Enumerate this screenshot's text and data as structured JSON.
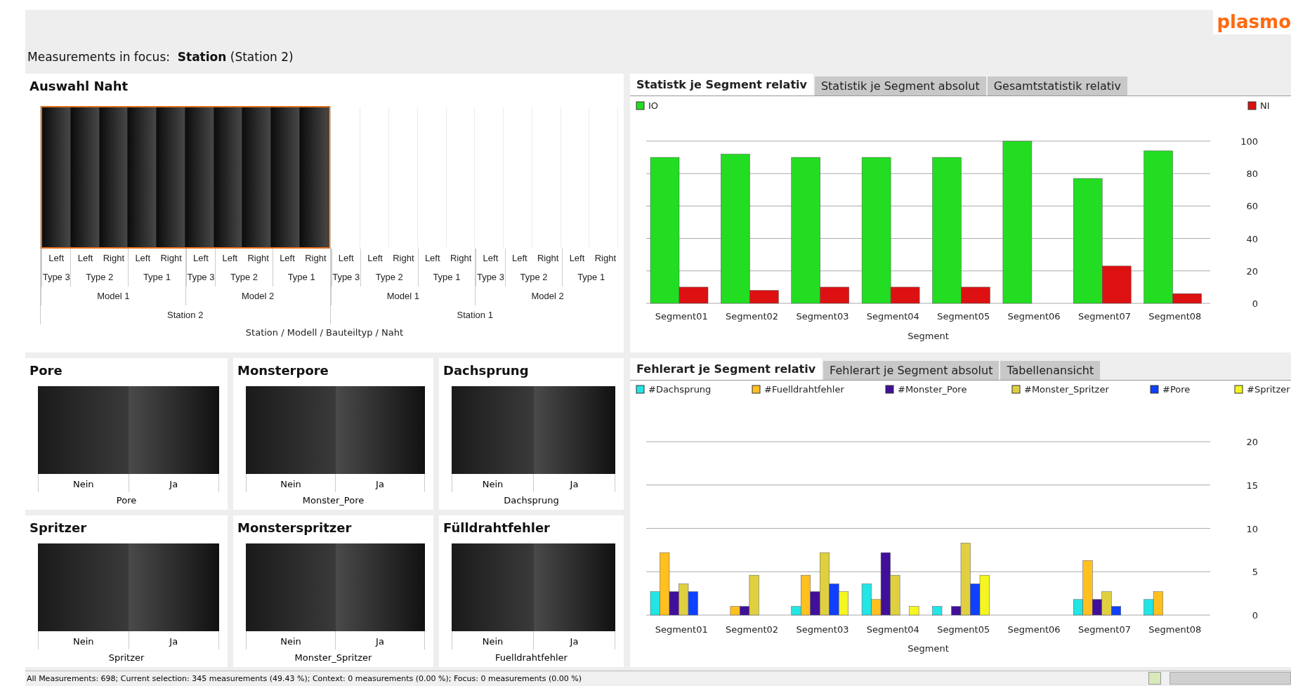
{
  "header": {
    "focus_label": "Measurements in focus:",
    "focus_value": "Station",
    "focus_detail": "(Station 2)",
    "logo": "plasmo"
  },
  "seam_selection": {
    "title": "Auswahl Naht",
    "xlabel": "Station / Modell / Bauteiltyp / Naht",
    "stations": [
      {
        "label": "Station 2",
        "selected": true,
        "children": [
          {
            "label": "Model 1",
            "children": [
              {
                "label": "Type 3",
                "children": [
                  {
                    "label": "Left"
                  }
                ]
              },
              {
                "label": "Type 2",
                "children": [
                  {
                    "label": "Left"
                  },
                  {
                    "label": "Right"
                  }
                ]
              },
              {
                "label": "Type 1",
                "children": [
                  {
                    "label": "Left"
                  },
                  {
                    "label": "Right"
                  }
                ]
              }
            ]
          },
          {
            "label": "Model 2",
            "children": [
              {
                "label": "Type 3",
                "children": [
                  {
                    "label": "Left"
                  }
                ]
              },
              {
                "label": "Type 2",
                "children": [
                  {
                    "label": "Left"
                  },
                  {
                    "label": "Right"
                  }
                ]
              },
              {
                "label": "Type 1",
                "children": [
                  {
                    "label": "Left"
                  },
                  {
                    "label": "Right"
                  }
                ]
              }
            ]
          }
        ]
      },
      {
        "label": "Station 1",
        "selected": false,
        "children": [
          {
            "label": "Model 1",
            "children": [
              {
                "label": "Type 3",
                "children": [
                  {
                    "label": "Left"
                  }
                ]
              },
              {
                "label": "Type 2",
                "children": [
                  {
                    "label": "Left"
                  },
                  {
                    "label": "Right"
                  }
                ]
              },
              {
                "label": "Type 1",
                "children": [
                  {
                    "label": "Left"
                  },
                  {
                    "label": "Right"
                  }
                ]
              }
            ]
          },
          {
            "label": "Model 2",
            "children": [
              {
                "label": "Type 3",
                "children": [
                  {
                    "label": "Left"
                  }
                ]
              },
              {
                "label": "Type 2",
                "children": [
                  {
                    "label": "Left"
                  },
                  {
                    "label": "Right"
                  }
                ]
              },
              {
                "label": "Type 1",
                "children": [
                  {
                    "label": "Left"
                  },
                  {
                    "label": "Right"
                  }
                ]
              }
            ]
          }
        ]
      }
    ]
  },
  "segment_statistics": {
    "tabs": [
      {
        "label": "Statistk je Segment relativ",
        "selected": true
      },
      {
        "label": "Statistik je Segment absolut",
        "selected": false
      },
      {
        "label": "Gesamtstatistik relativ",
        "selected": false
      }
    ],
    "chart_data": {
      "type": "bar",
      "grid": true,
      "xlabel": "Segment",
      "categories": [
        "Segment01",
        "Segment02",
        "Segment03",
        "Segment04",
        "Segment05",
        "Segment06",
        "Segment07",
        "Segment08"
      ],
      "ylim": [
        0,
        100
      ],
      "legend": true,
      "yticks": [
        0,
        20,
        40,
        60,
        80,
        100
      ],
      "series": [
        {
          "name": "IO",
          "color": "#22dd22",
          "values": [
            90,
            92,
            90,
            90,
            90,
            100,
            77,
            94
          ]
        },
        {
          "name": "NI",
          "color": "#dd1111",
          "values": [
            10,
            8,
            10,
            10,
            10,
            0,
            23,
            6
          ]
        }
      ]
    }
  },
  "defect_panels": [
    {
      "title": "Pore",
      "categories": [
        "Nein",
        "Ja"
      ],
      "xlabel": "Pore"
    },
    {
      "title": "Monsterpore",
      "categories": [
        "Nein",
        "Ja"
      ],
      "xlabel": "Monster_Pore"
    },
    {
      "title": "Dachsprung",
      "categories": [
        "Nein",
        "Ja"
      ],
      "xlabel": "Dachsprung"
    },
    {
      "title": "Spritzer",
      "categories": [
        "Nein",
        "Ja"
      ],
      "xlabel": "Spritzer"
    },
    {
      "title": "Monsterspritzer",
      "categories": [
        "Nein",
        "Ja"
      ],
      "xlabel": "Monster_Spritzer"
    },
    {
      "title": "Fülldrahtfehler",
      "categories": [
        "Nein",
        "Ja"
      ],
      "xlabel": "Fuelldrahtfehler"
    }
  ],
  "defect_statistics": {
    "tabs": [
      {
        "label": "Fehlerart je Segment relativ",
        "selected": true
      },
      {
        "label": "Fehlerart je Segment absolut",
        "selected": false
      },
      {
        "label": "Tabellenansicht",
        "selected": false
      }
    ],
    "chart_data": {
      "type": "bar",
      "grid": true,
      "xlabel": "Segment",
      "categories": [
        "Segment01",
        "Segment02",
        "Segment03",
        "Segment04",
        "Segment05",
        "Segment06",
        "Segment07",
        "Segment08"
      ],
      "ylim": [
        0,
        20
      ],
      "legend": true,
      "yticks": [
        0,
        5,
        10,
        15,
        20
      ],
      "series": [
        {
          "name": "#Dachsprung",
          "color": "#22e5e5",
          "values": [
            2.7,
            0,
            1,
            3.6,
            1,
            0,
            1.8,
            1.8
          ]
        },
        {
          "name": "#Fuelldrahtfehler",
          "color": "#ffc020",
          "values": [
            7.2,
            1,
            4.6,
            1.8,
            0,
            0,
            6.3,
            2.7
          ]
        },
        {
          "name": "#Monster_Pore",
          "color": "#40109a",
          "values": [
            2.7,
            1,
            2.7,
            7.2,
            1,
            0,
            1.8,
            0
          ]
        },
        {
          "name": "#Monster_Spritzer",
          "color": "#e0d040",
          "values": [
            3.6,
            4.6,
            7.2,
            4.6,
            8.3,
            0,
            2.7,
            0
          ]
        },
        {
          "name": "#Pore",
          "color": "#1040ff",
          "values": [
            2.7,
            0,
            3.6,
            0,
            3.6,
            0,
            1,
            0
          ]
        },
        {
          "name": "#Spritzer",
          "color": "#f5f520",
          "values": [
            0,
            0,
            2.7,
            1,
            4.6,
            0,
            0,
            0
          ]
        }
      ]
    }
  },
  "status_bar": {
    "text": "All Measurements: 698; Current selection: 345 measurements (49.43 %); Context: 0 measurements (0.00 %); Focus: 0 measurements (0.00 %)"
  }
}
